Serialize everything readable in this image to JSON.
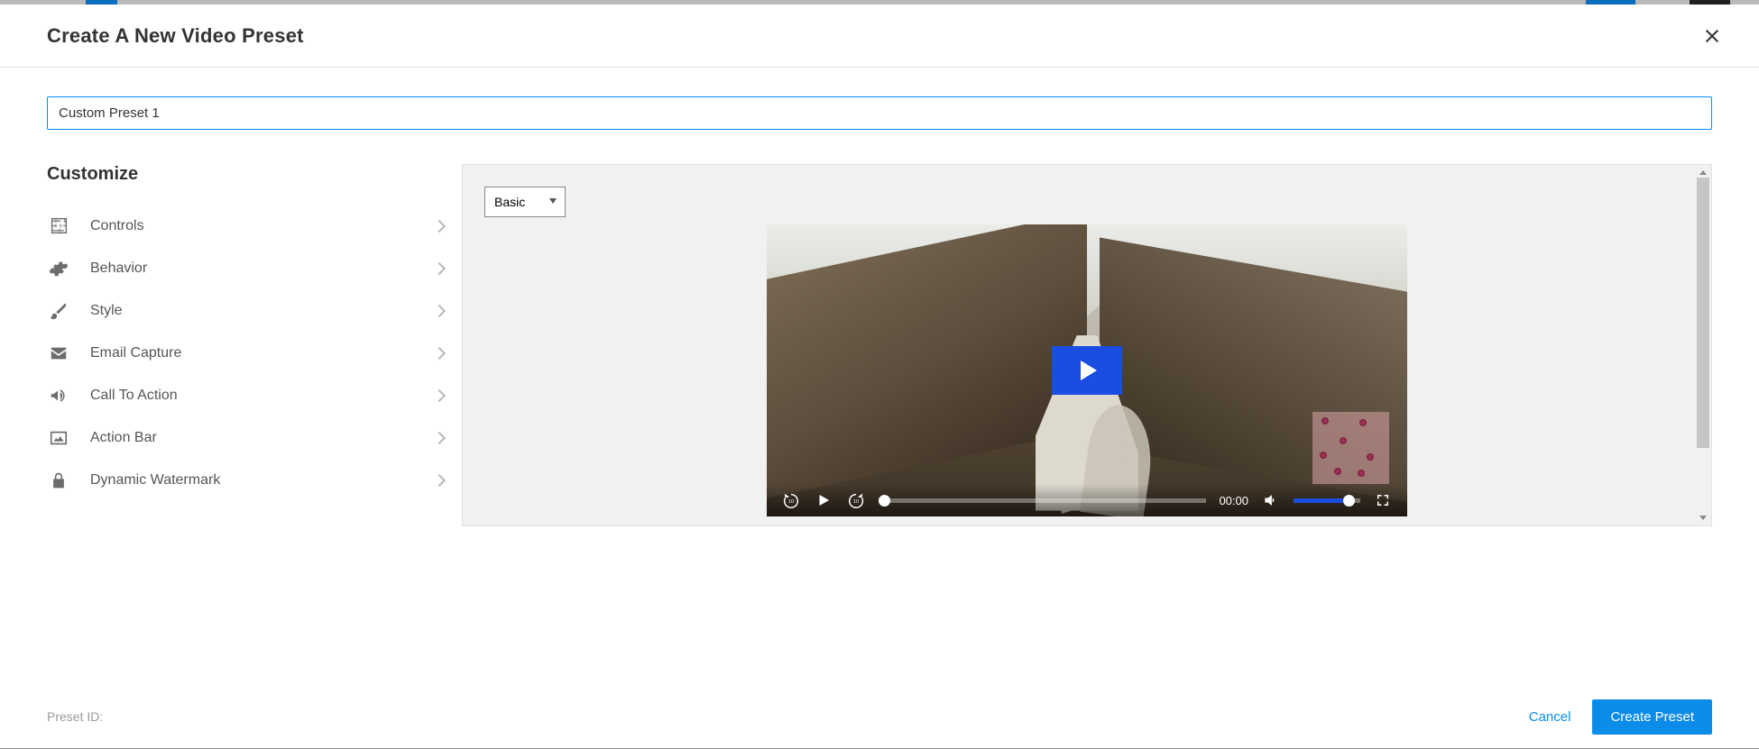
{
  "header": {
    "title": "Create A New Video Preset"
  },
  "input": {
    "preset_name_value": "Custom Preset 1"
  },
  "sidebar": {
    "heading": "Customize",
    "items": [
      {
        "label": "Controls"
      },
      {
        "label": "Behavior"
      },
      {
        "label": "Style"
      },
      {
        "label": "Email Capture"
      },
      {
        "label": "Call To Action"
      },
      {
        "label": "Action Bar"
      },
      {
        "label": "Dynamic Watermark"
      }
    ]
  },
  "preview": {
    "skin_selected": "Basic",
    "time_current": "00:00"
  },
  "footer": {
    "preset_id_label": "Preset ID:",
    "cancel": "Cancel",
    "create": "Create Preset"
  }
}
